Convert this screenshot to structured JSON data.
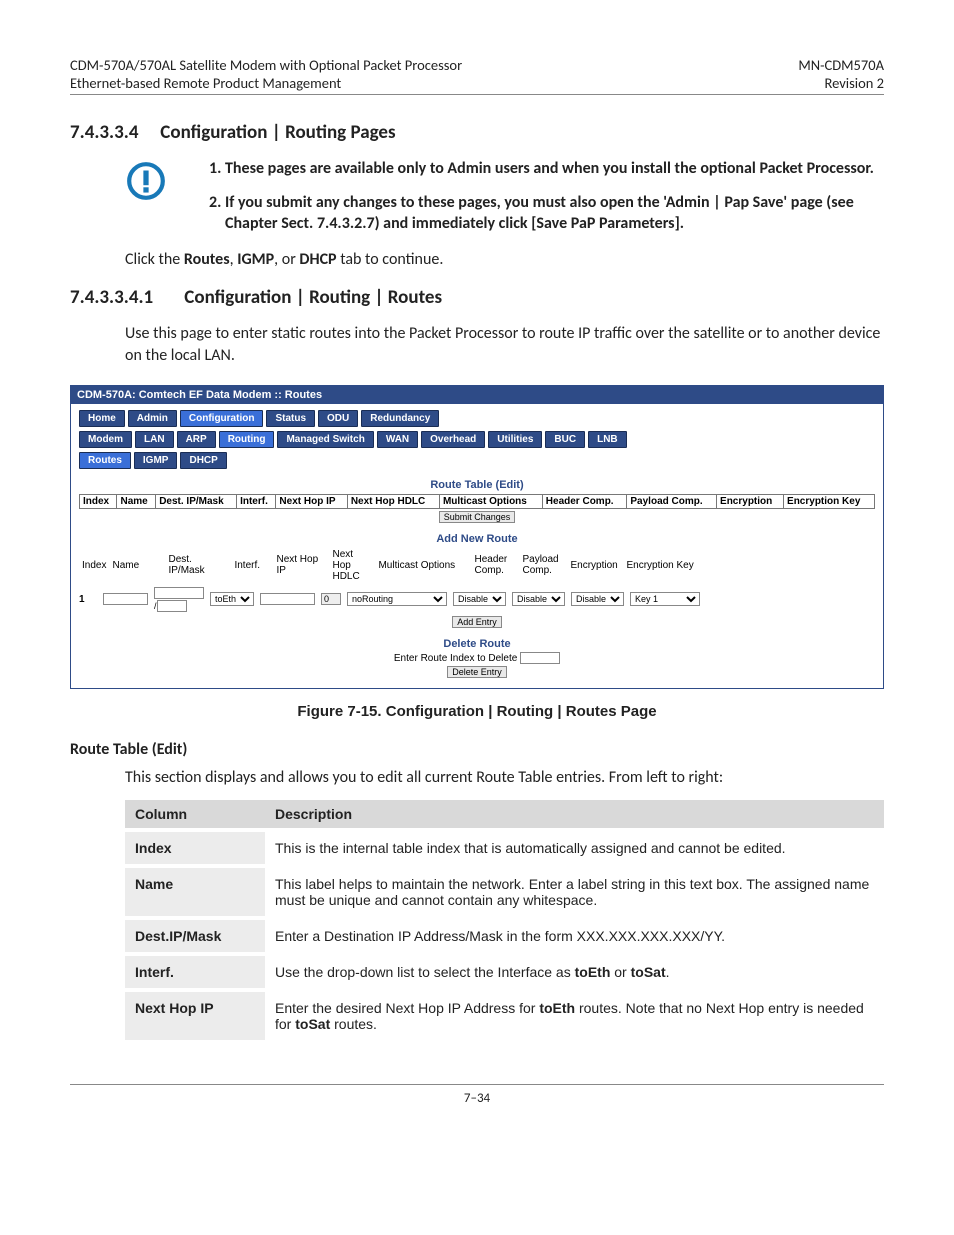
{
  "header": {
    "left1": "CDM-570A/570AL Satellite Modem with Optional Packet Processor",
    "left2": "Ethernet-based Remote Product Management",
    "right1": "MN-CDM570A",
    "right2": "Revision 2"
  },
  "section1": {
    "num": "7.4.3.3.4",
    "title": "Configuration | Routing Pages"
  },
  "notes": {
    "n1": "These pages are available only to Admin users and when you install the optional Packet Processor.",
    "n2": "If you submit any changes to these pages, you must also open the 'Admin | Pap Save' page (see Chapter Sect. 7.4.3.2.7) and immediately click [Save PaP Parameters]."
  },
  "click_line": {
    "pre": "Click the ",
    "b1": "Routes",
    "mid1": ", ",
    "b2": "IGMP",
    "mid2": ", or  ",
    "b3": "DHCP",
    "post": " tab to continue."
  },
  "section2": {
    "num": "7.4.3.3.4.1",
    "title": "Configuration | Routing | Routes"
  },
  "intro": "Use this page to enter static routes into the Packet Processor to route IP traffic over the satellite or to another device on the local LAN.",
  "figure": {
    "title": "CDM-570A: Comtech EF Data Modem :: Routes",
    "tabs1": [
      "Home",
      "Admin",
      "Configuration",
      "Status",
      "ODU",
      "Redundancy"
    ],
    "tabs2": [
      "Modem",
      "LAN",
      "ARP",
      "Routing",
      "Managed Switch",
      "WAN",
      "Overhead",
      "Utilities",
      "BUC",
      "LNB"
    ],
    "tabs3": [
      "Routes",
      "IGMP",
      "DHCP"
    ],
    "rte_hdr": "Route Table (Edit)",
    "rte_cols": [
      "Index",
      "Name",
      "Dest. IP/Mask",
      "Interf.",
      "Next Hop IP",
      "Next Hop HDLC",
      "Multicast Options",
      "Header Comp.",
      "Payload Comp.",
      "Encryption",
      "Encryption Key"
    ],
    "submit": "Submit Changes",
    "add_hdr": "Add New Route",
    "add_cols": [
      "Index",
      "Name",
      "Dest. IP/Mask",
      "Interf.",
      "Next Hop IP",
      "Next Hop HDLC",
      "Multicast Options",
      "Header Comp.",
      "Payload Comp.",
      "Encryption",
      "Encryption Key"
    ],
    "add_row": {
      "index": "1",
      "interf": "toEth",
      "nexthopip": "",
      "nexthophdlc": "0",
      "multicast": "noRouting",
      "hcomp": "Disable",
      "pcomp": "Disable",
      "enc": "Disable",
      "key": "Key 1"
    },
    "add_btn": "Add Entry",
    "del_hdr": "Delete Route",
    "del_label": "Enter Route Index to Delete",
    "del_btn": "Delete Entry"
  },
  "figcap": "Figure 7-15. Configuration | Routing | Routes Page",
  "rte_h3": "Route Table (Edit)",
  "rte_p": "This section displays and allows you to edit all current Route Table entries. From left to right:",
  "defs": {
    "h1": "Column",
    "h2": "Description",
    "r1c": "Index",
    "r1d": "This is the internal table index that is automatically assigned and cannot be edited.",
    "r2c": "Name",
    "r2d": "This label helps to maintain the network. Enter a label string in this text box. The assigned name must be unique and cannot contain any whitespace.",
    "r3c": "Dest.IP/Mask",
    "r3d": "Enter a Destination IP Address/Mask in the form XXX.XXX.XXX.XXX/YY.",
    "r4c": "Interf.",
    "r4d_pre": "Use the drop-down list to select the Interface as ",
    "r4d_b1": "toEth",
    "r4d_mid": " or ",
    "r4d_b2": "toSat",
    "r4d_post": ".",
    "r5c": "Next Hop IP",
    "r5d_pre": "Enter the desired Next Hop IP Address for ",
    "r5d_b1": "toEth",
    "r5d_mid": " routes. Note that no Next Hop entry is needed for ",
    "r5d_b2": "toSat",
    "r5d_post": " routes."
  },
  "pagenum": "7–34"
}
